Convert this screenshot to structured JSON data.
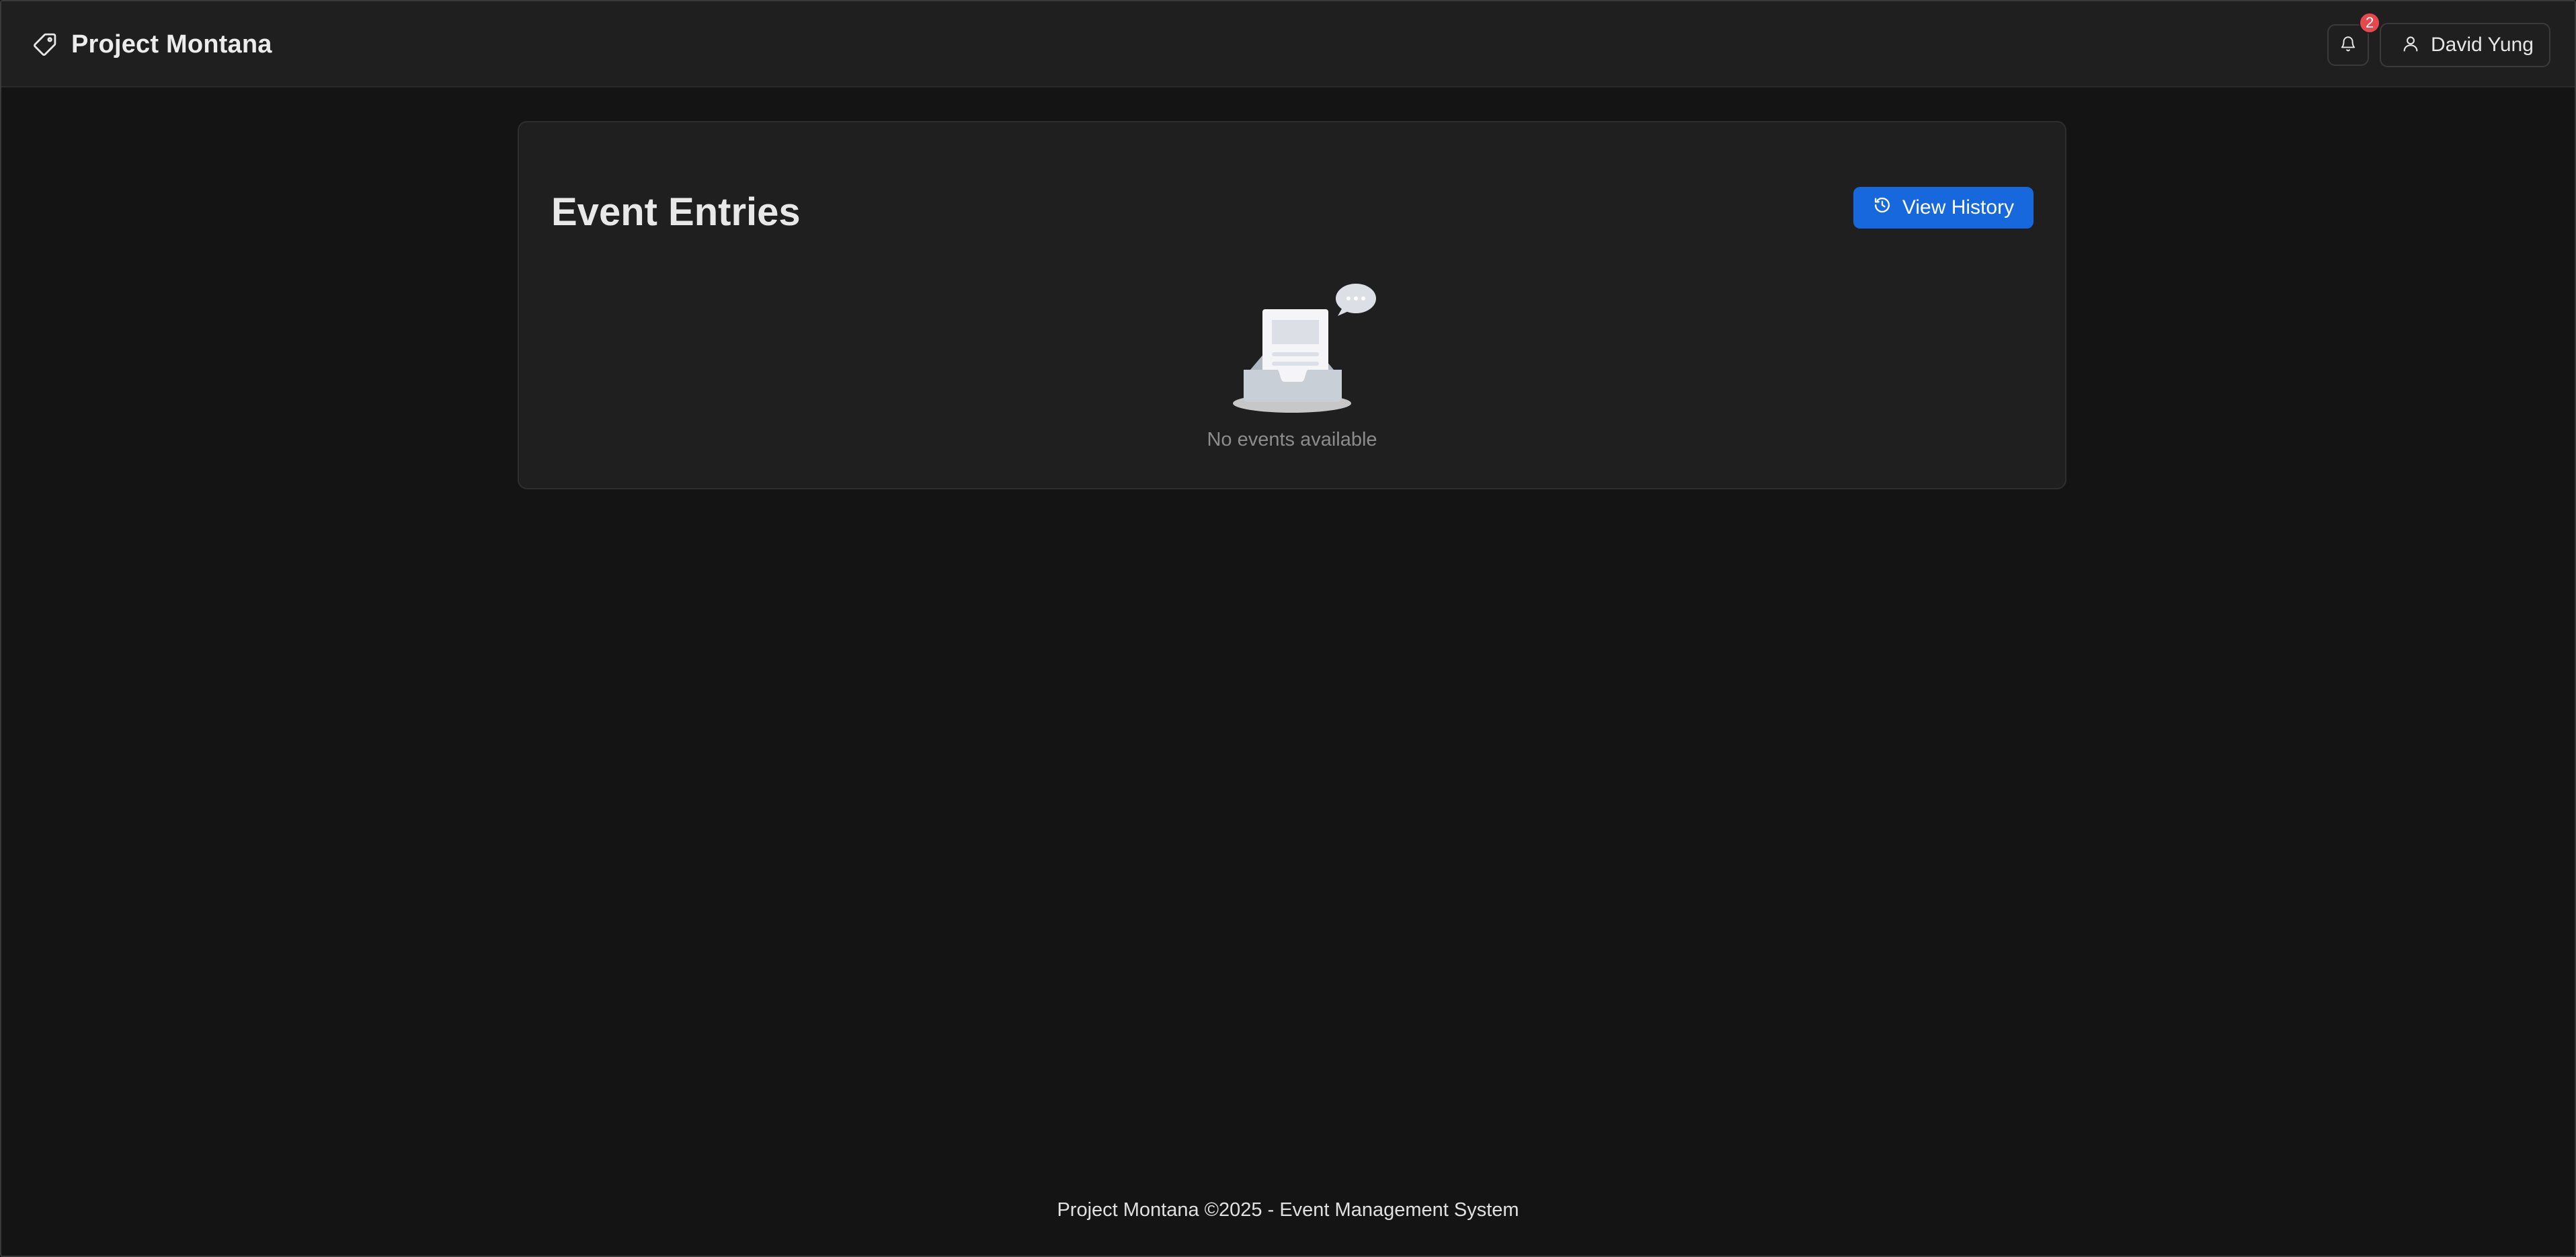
{
  "app": {
    "title": "Project Montana",
    "brand_icon": "tag-icon"
  },
  "header": {
    "notifications": {
      "icon": "bell-icon",
      "count": "2"
    },
    "user": {
      "icon": "user-icon",
      "name": "David Yung"
    }
  },
  "main": {
    "title": "Event Entries",
    "view_history_label": "View History",
    "view_history_icon": "history-icon",
    "empty_state": {
      "icon": "empty-inbox-icon",
      "text": "No events available"
    }
  },
  "footer": {
    "text": "Project Montana ©2025 - Event Management System"
  },
  "colors": {
    "background": "#141414",
    "surface": "#1f1f1f",
    "primary": "#1668dc",
    "badge": "#e5484d",
    "muted_text": "#8c8c8c"
  }
}
